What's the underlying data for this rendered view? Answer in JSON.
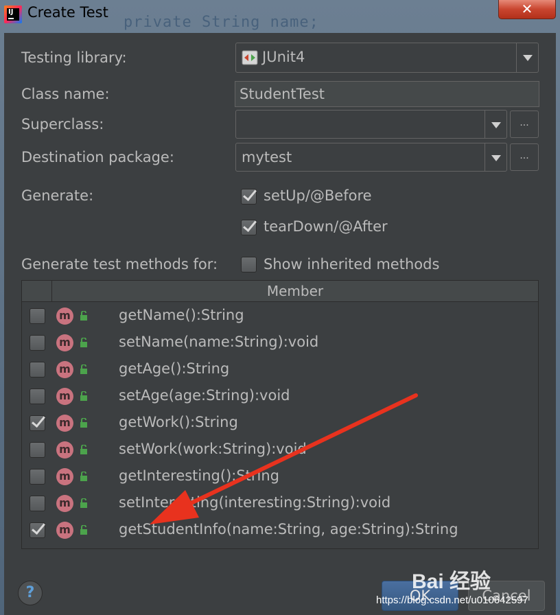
{
  "window": {
    "title": "Create Test",
    "background_code": "private String name;",
    "close_glyph": "✕"
  },
  "form": {
    "testing_library_label": "Testing library:",
    "testing_library_value": "JUnit4",
    "class_name_label": "Class name:",
    "class_name_value": "StudentTest",
    "superclass_label": "Superclass:",
    "superclass_value": "",
    "destination_package_label": "Destination package:",
    "destination_package_value": "mytest",
    "dots_label": "...",
    "generate_label": "Generate:",
    "setup_label": "setUp/@Before",
    "setup_checked": true,
    "teardown_label": "tearDown/@After",
    "teardown_checked": true,
    "methods_for_label": "Generate test methods for:",
    "show_inherited_label": "Show inherited methods",
    "show_inherited_checked": false
  },
  "table": {
    "header_member": "Member",
    "rows": [
      {
        "name": "getName():String",
        "checked": false
      },
      {
        "name": "setName(name:String):void",
        "checked": false
      },
      {
        "name": "getAge():String",
        "checked": false
      },
      {
        "name": "setAge(age:String):void",
        "checked": false
      },
      {
        "name": "getWork():String",
        "checked": true
      },
      {
        "name": "setWork(work:String):void",
        "checked": false
      },
      {
        "name": "getInteresting():String",
        "checked": false
      },
      {
        "name": "setInteresting(interesting:String):void",
        "checked": false
      },
      {
        "name": "getStudentInfo(name:String, age:String):String",
        "checked": true
      }
    ],
    "method_icon_letter": "m"
  },
  "buttons": {
    "help": "?",
    "ok": "OK",
    "cancel": "Cancel"
  },
  "watermark": {
    "brand": "Bai 经验",
    "url": "https://blog.csdn.net/u010642597"
  },
  "colors": {
    "dialog_bg": "#3c3f41",
    "arrow": "#e8321e",
    "method_icon": "#c9737f",
    "lock_icon": "#4ca34c"
  },
  "icons": {
    "app": "intellij-idea-icon",
    "junit": "junit-icon",
    "method": "method-icon",
    "lock": "lock-open-icon"
  }
}
